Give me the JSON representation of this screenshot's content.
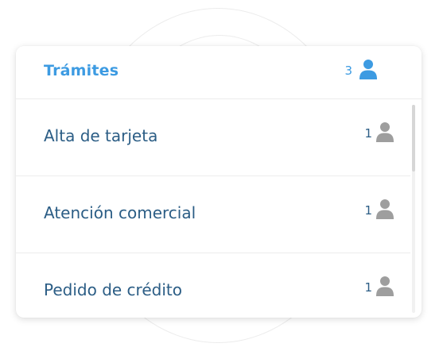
{
  "header": {
    "title": "Trámites",
    "count": "3",
    "icon": "user-icon",
    "accent_color": "#3d9be2"
  },
  "items": [
    {
      "label": "Alta de tarjeta",
      "count": "1",
      "icon": "user-icon"
    },
    {
      "label": "Atención comercial",
      "count": "1",
      "icon": "user-icon"
    },
    {
      "label": "Pedido de crédito",
      "count": "1",
      "icon": "user-icon"
    }
  ],
  "colors": {
    "item_text": "#2b5d85",
    "icon_gray": "#9e9e9e"
  }
}
